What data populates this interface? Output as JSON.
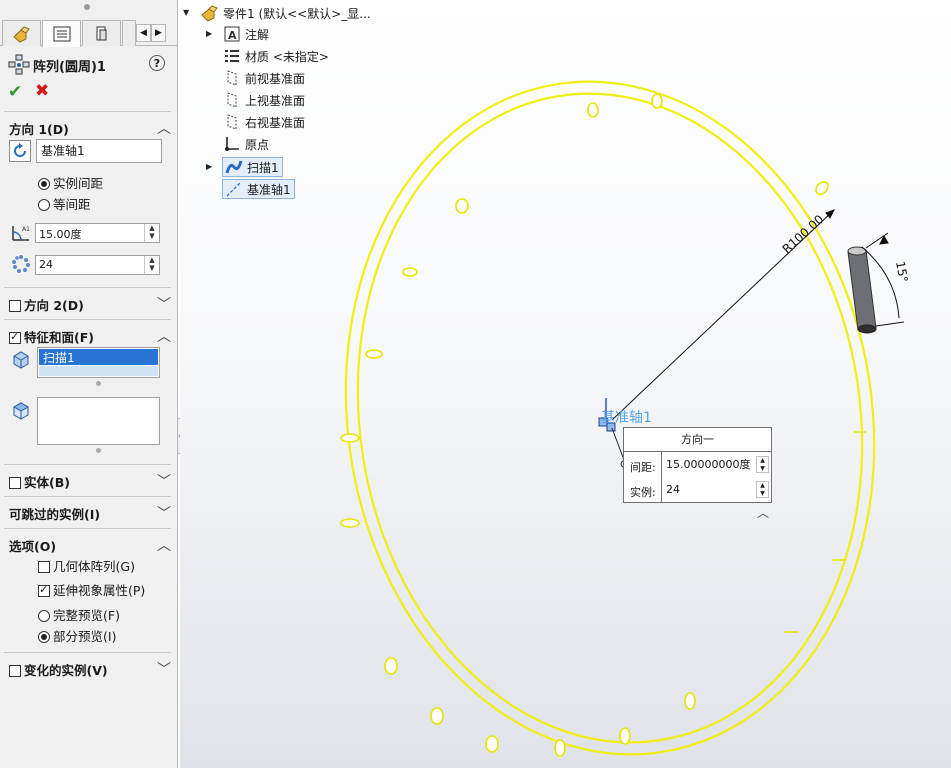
{
  "panel": {
    "tabs": [
      {
        "icon": "feature-manager-icon",
        "active": false
      },
      {
        "icon": "property-manager-icon",
        "active": true
      },
      {
        "icon": "configuration-manager-icon",
        "active": false
      }
    ],
    "title": "阵列(圆周)1",
    "direction1": {
      "label": "方向 1(D)",
      "axis_value": "基准轴1",
      "spacing_option": "实例间距",
      "equal_option": "等间距",
      "angle": "15.00度",
      "count": "24"
    },
    "direction2": {
      "label": "方向 2(D)"
    },
    "features": {
      "label": "特征和面(F)",
      "selected": "扫描1"
    },
    "bodies": {
      "label": "实体(B)"
    },
    "skip": {
      "label": "可跳过的实例(I)"
    },
    "options": {
      "label": "选项(O)",
      "geometry_pattern": "几何体阵列(G)",
      "propagate_visual": "延伸视象属性(P)",
      "full_preview": "完整预览(F)",
      "partial_preview": "部分预览(I)"
    },
    "vary": {
      "label": "变化的实例(V)"
    }
  },
  "tree": {
    "root": "零件1  (默认<<默认>_显...",
    "items": [
      "注解",
      "材质 <未指定>",
      "前视基准面",
      "上视基准面",
      "右视基准面",
      "原点",
      "扫描1",
      "基准轴1"
    ]
  },
  "viewport": {
    "axis_label": "基准轴1",
    "radius_dim": "R100.00",
    "angle_dim": "15°",
    "popup": {
      "title": "方向一",
      "spacing_label": "间距:",
      "spacing_value": "15.00000000度",
      "count_label": "实例:",
      "count_value": "24"
    }
  },
  "colors": {
    "ring": "#f2f21a",
    "selection": "#2774d4",
    "axis": "#5aa2e6"
  }
}
